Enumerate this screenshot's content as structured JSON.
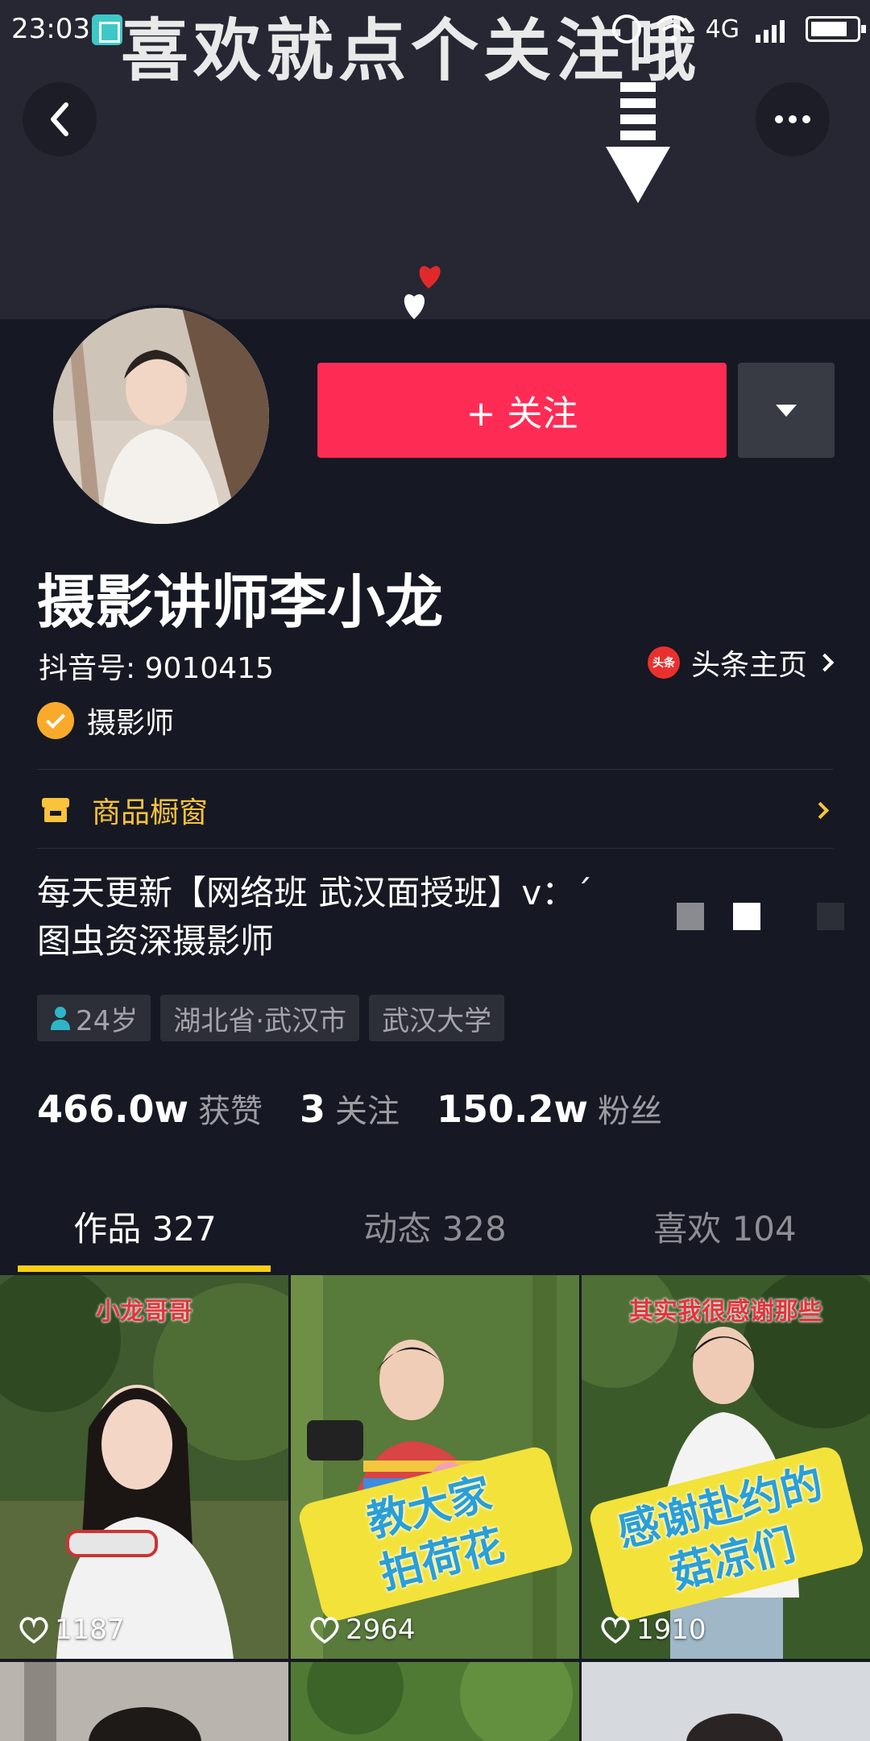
{
  "status_bar": {
    "time": "23:03",
    "network": "4G"
  },
  "banner": {
    "overlay_text": "喜欢就点个关注哦"
  },
  "profile": {
    "name": "摄影讲师李小龙",
    "douyin_id": "抖音号: 9010415",
    "toutiao_icon": "头条",
    "toutiao_link": "头条主页",
    "verification": "摄影师",
    "shop_window": "商品橱窗",
    "bio_line1": "每天更新【网络班 武汉面授班】v：´",
    "bio_line2": "图虫资深摄影师",
    "tags": [
      "24岁",
      "湖北省·武汉市",
      "武汉大学"
    ],
    "follow_button": "+ 关注"
  },
  "stats": [
    {
      "num": "466.0w",
      "label": "获赞"
    },
    {
      "num": "3",
      "label": "关注"
    },
    {
      "num": "150.2w",
      "label": "粉丝"
    }
  ],
  "tabs": [
    {
      "label": "作品 327",
      "active": true
    },
    {
      "label": "动态 328",
      "active": false
    },
    {
      "label": "喜欢 104",
      "active": false
    }
  ],
  "videos": [
    {
      "title": "小龙哥哥",
      "likes": "1187"
    },
    {
      "title": "",
      "caption": [
        "教大家",
        "拍荷花"
      ],
      "likes": "2964"
    },
    {
      "title": "其实我很感谢那些",
      "caption": [
        "感谢赴约的",
        "菇凉们"
      ],
      "likes": "1910"
    }
  ],
  "colors": {
    "accent_red": "#fe2c55",
    "tab_indicator": "#face15",
    "shop_yellow": "#f9c33c",
    "background": "#161823"
  }
}
